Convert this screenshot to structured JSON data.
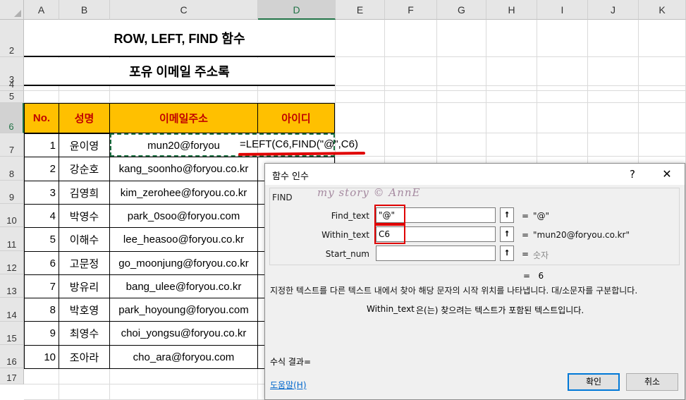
{
  "columns": [
    "A",
    "B",
    "C",
    "D",
    "E",
    "F",
    "G",
    "H",
    "I",
    "J",
    "K"
  ],
  "rows": [
    "2",
    "3",
    "4",
    "5",
    "6",
    "7",
    "8",
    "9",
    "10",
    "11",
    "12",
    "13",
    "14",
    "15",
    "16",
    "17"
  ],
  "selected": {
    "col": "D",
    "row": "6"
  },
  "titles": {
    "t1": "ROW, LEFT, FIND 함수",
    "t2": "포유 이메일 주소록"
  },
  "table": {
    "headers": {
      "no": "No.",
      "name": "성명",
      "email": "이메일주소",
      "id": "아이디"
    },
    "rows": [
      {
        "no": "1",
        "name": "윤이영",
        "email": "mun20@foryou"
      },
      {
        "no": "2",
        "name": "강순호",
        "email": "kang_soonho@foryou.co.kr"
      },
      {
        "no": "3",
        "name": "김영희",
        "email": "kim_zerohee@foryou.co.kr"
      },
      {
        "no": "4",
        "name": "박영수",
        "email": "park_0soo@foryou.com"
      },
      {
        "no": "5",
        "name": "이해수",
        "email": "lee_heasoo@foryou.co.kr"
      },
      {
        "no": "6",
        "name": "고문정",
        "email": "go_moonjung@foryou.co.kr"
      },
      {
        "no": "7",
        "name": "방유리",
        "email": "bang_ulee@foryou.co.kr"
      },
      {
        "no": "8",
        "name": "박호영",
        "email": "park_hoyoung@foryou.com"
      },
      {
        "no": "9",
        "name": "최영수",
        "email": "choi_yongsu@foryou.co.kr"
      },
      {
        "no": "10",
        "name": "조아라",
        "email": "cho_ara@foryou.com"
      }
    ]
  },
  "formula": "=LEFT(C6,FIND(\"@\",C6)",
  "dialog": {
    "title": "함수 인수",
    "help_q": "?",
    "close": "✕",
    "watermark": "my story © AnnE",
    "function_name": "FIND",
    "args": [
      {
        "label": "Find_text",
        "value": "\"@\"",
        "result": "\"@\""
      },
      {
        "label": "Within_text",
        "value": "C6",
        "result": "\"mun20@foryou.co.kr\""
      },
      {
        "label": "Start_num",
        "value": "",
        "result": "숫자"
      }
    ],
    "eq": "=",
    "result": "6",
    "description": "지정한 텍스트를 다른 텍스트 내에서 찾아 해당 문자의 시작 위치를 나타냅니다. 대/소문자를 구분합니다.",
    "arg_desc_name": "Within_text",
    "arg_desc_text": "은(는) 찾으려는 텍스트가 포함된 텍스트입니다.",
    "formula_result_label": "수식 결과=",
    "help_link": "도움말(H)",
    "ok": "확인",
    "cancel": "취소"
  }
}
